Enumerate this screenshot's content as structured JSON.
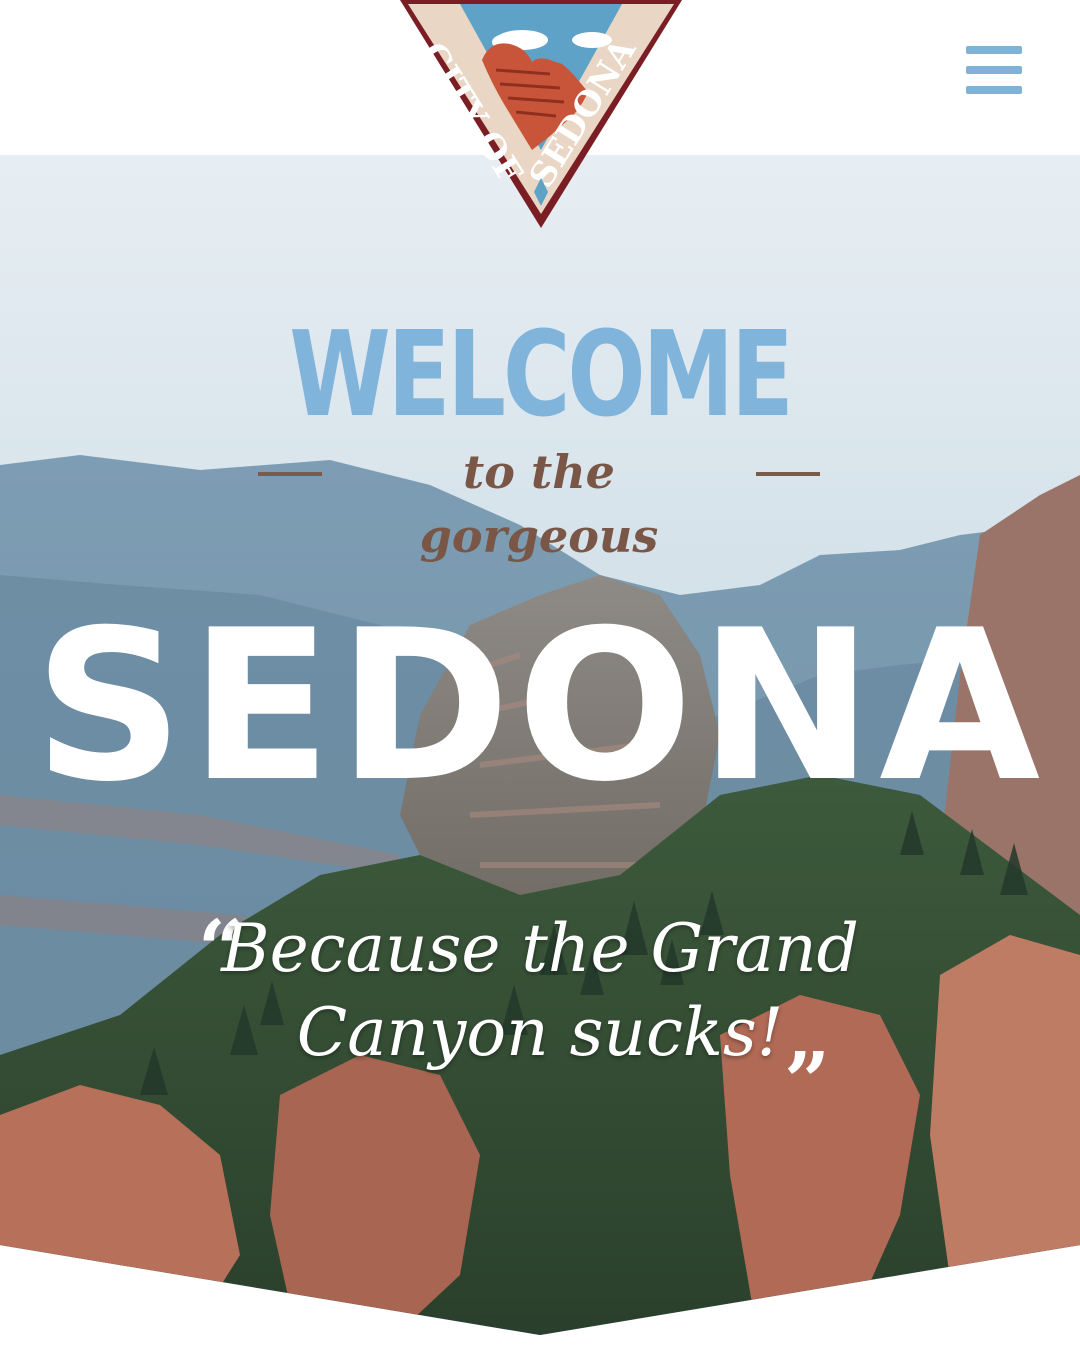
{
  "header": {
    "logo_text": "CITY OF SEDONA",
    "menu_icon": "hamburger-menu-icon"
  },
  "hero": {
    "welcome": "WELCOME",
    "subtitle": "to the gorgeous",
    "title": "SEDONA",
    "quote_open": "“",
    "quote_line1": "Because the Grand",
    "quote_line2": "Canyon sucks!",
    "quote_close": "”"
  },
  "colors": {
    "accent_blue": "#80b4db",
    "accent_brown": "#7a5646",
    "logo_maroon": "#7b1e24",
    "logo_rock": "#c8553a",
    "logo_sky": "#5fa2c8"
  }
}
